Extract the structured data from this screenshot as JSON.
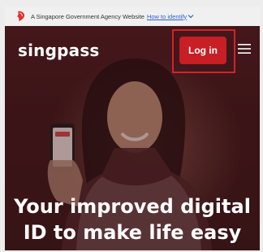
{
  "masthead": {
    "text": "A Singapore Government Agency Website",
    "link": "How to identify"
  },
  "header": {
    "logo": "singpass",
    "login_label": "Log in"
  },
  "hero": {
    "headline_line1": "Your improved digital",
    "headline_line2": "ID to make life easy"
  },
  "colors": {
    "brand_red": "#c81e25",
    "hero_bg": "#3b1518",
    "link_blue": "#2f5fd0"
  },
  "icons": {
    "masthead": "lion-head-icon",
    "link": "chevron-down-icon",
    "menu": "hamburger-menu-icon"
  }
}
